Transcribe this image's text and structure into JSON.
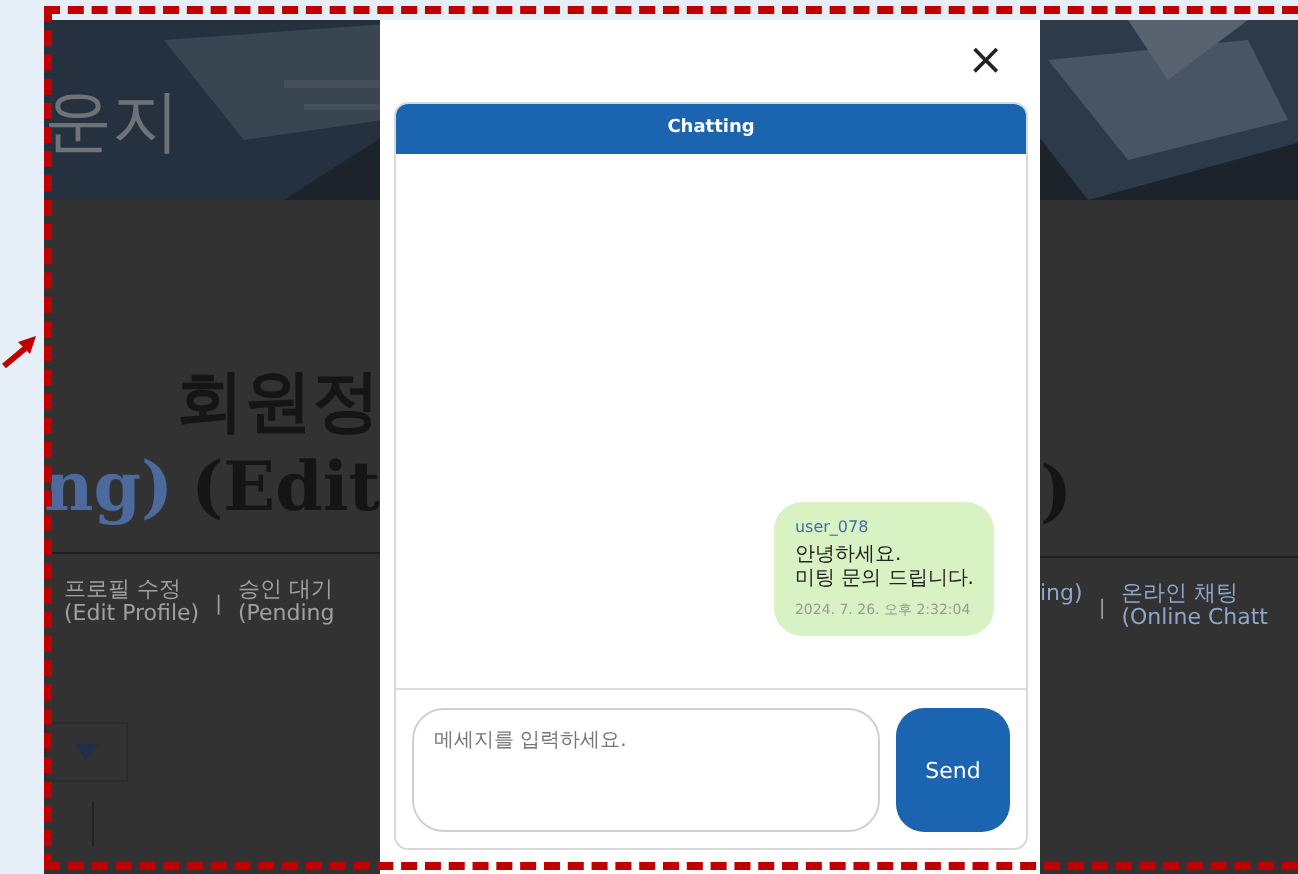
{
  "background_page": {
    "banner_title": "운지",
    "heading": {
      "line_1": "회원정",
      "line_2_left": "ng)",
      "line_2_middle": "(Edit",
      "line_2_right": ")"
    },
    "nav_left": [
      {
        "kind": "link",
        "label": "프로필 수정",
        "sublabel": "(Edit Profile)"
      },
      {
        "kind": "separator",
        "text": "|"
      },
      {
        "kind": "link",
        "label": "승인 대기",
        "sublabel": "(Pending"
      }
    ],
    "nav_right": [
      {
        "kind": "link",
        "sublabel": "ing)"
      },
      {
        "kind": "separator",
        "text": "|"
      },
      {
        "kind": "link",
        "label": "온라인 채팅",
        "sublabel": "(Online Chatt"
      }
    ]
  },
  "modal": {
    "close": "×",
    "chat": {
      "title": "Chatting",
      "messages": [
        {
          "sender": "user_078",
          "text": "안녕하세요.\n미팅 문의 드립니다.",
          "time": "2024. 7. 26. 오후 2:32:04",
          "mine": true
        }
      ],
      "input": {
        "placeholder": "메세지를 입력하세요."
      },
      "send": "Send"
    }
  }
}
